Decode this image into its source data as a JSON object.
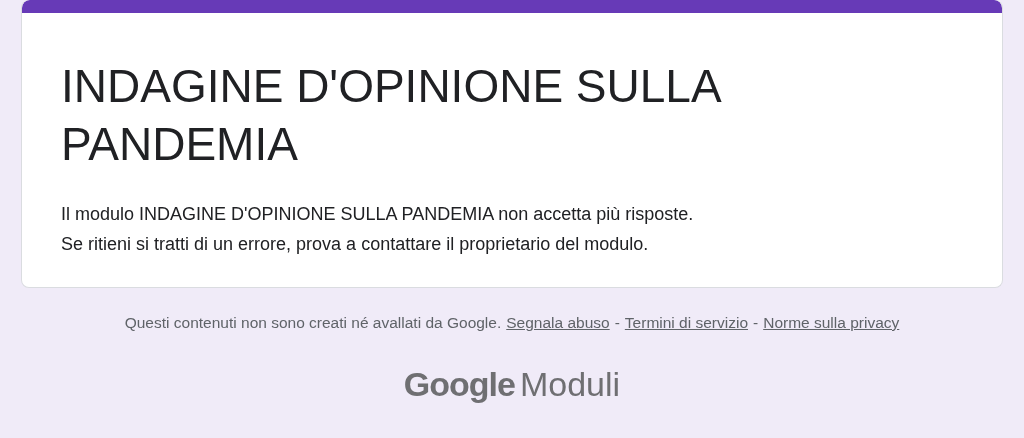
{
  "form": {
    "title": "INDAGINE D'OPINIONE SULLA PANDEMIA",
    "message_lines": [
      "Il modulo INDAGINE D'OPINIONE SULLA PANDEMIA non accetta più risposte.",
      "Se ritieni si tratti di un errore, prova a contattare il proprietario del modulo."
    ]
  },
  "footer": [
    {
      "kind": "text",
      "text": "Questi contenuti non sono creati né avallati da Google."
    },
    {
      "kind": "link",
      "text": "Segnala abuso"
    },
    {
      "kind": "separator",
      "text": "-"
    },
    {
      "kind": "link",
      "text": "Termini di servizio"
    },
    {
      "kind": "separator",
      "text": "-"
    },
    {
      "kind": "link",
      "text": "Norme sulla privacy"
    }
  ],
  "logo": {
    "brand": "Google",
    "product": "Moduli"
  }
}
